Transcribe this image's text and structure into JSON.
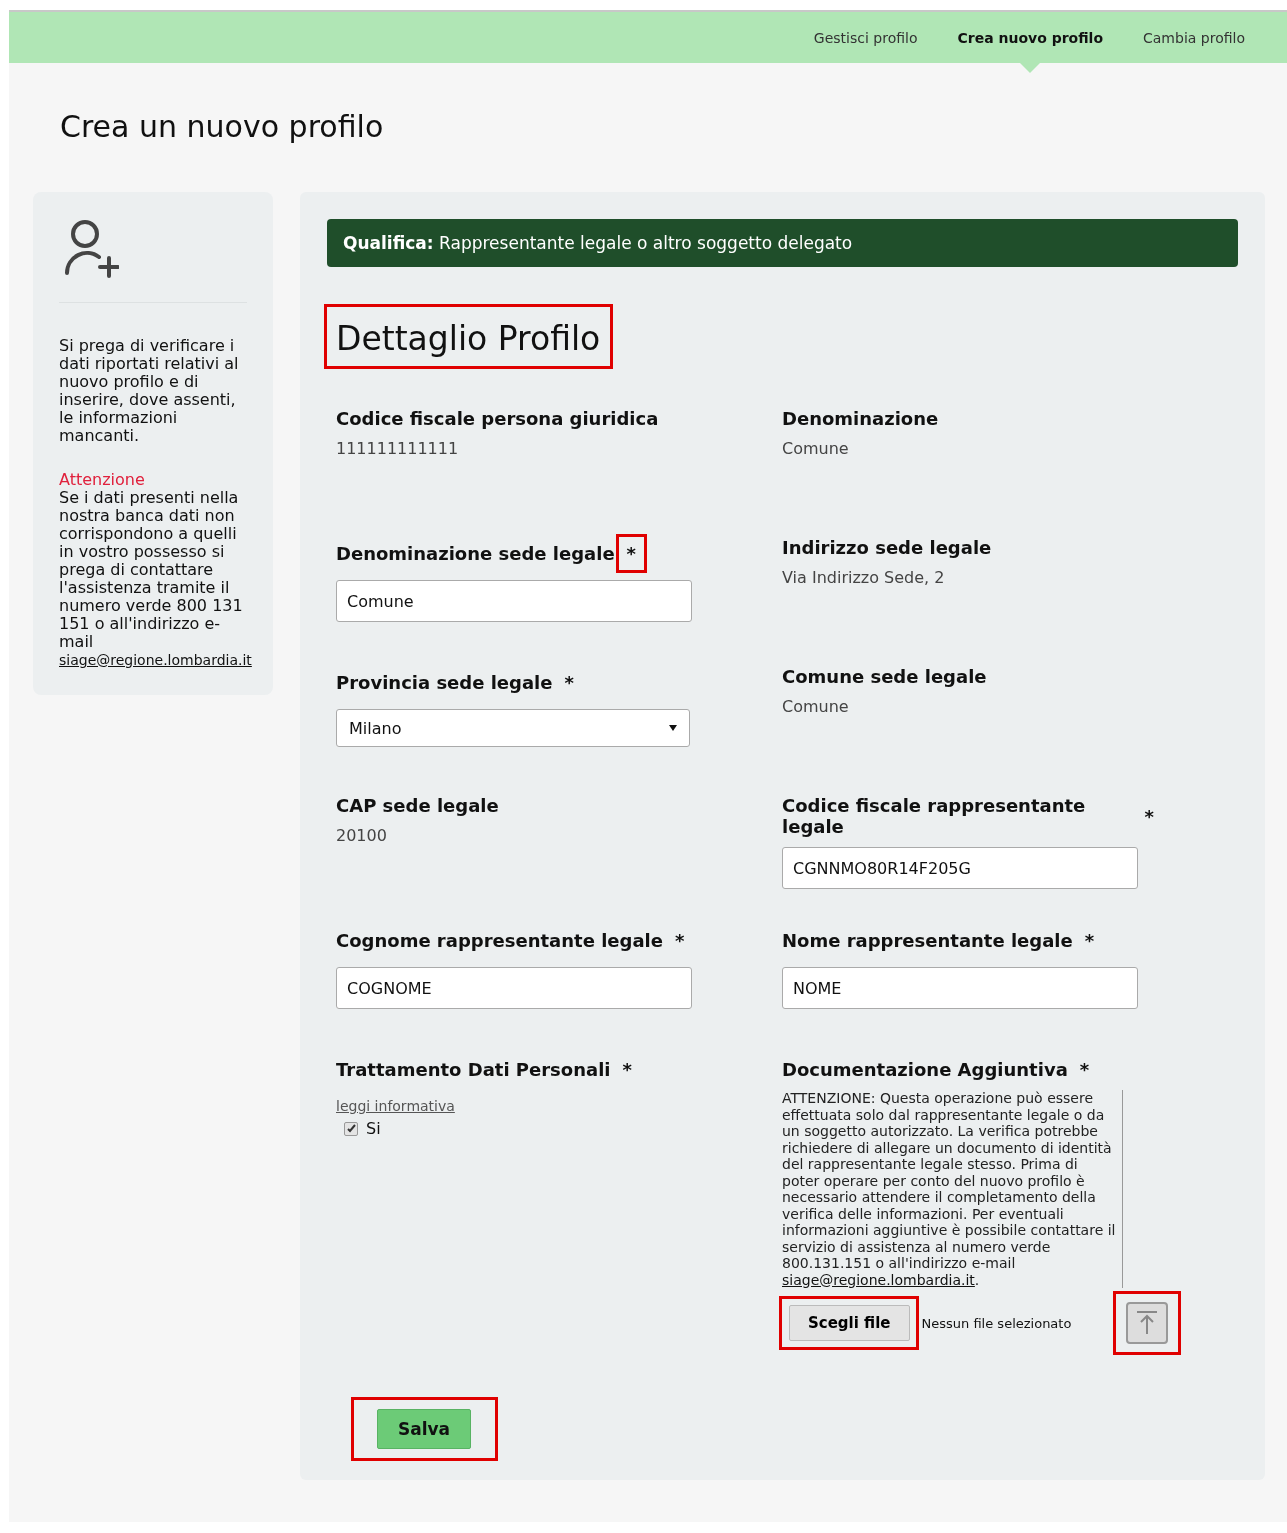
{
  "nav": {
    "items": [
      {
        "label": "Gestisci profilo",
        "selected": false
      },
      {
        "label": "Crea nuovo profilo",
        "selected": true
      },
      {
        "label": "Cambia profilo",
        "selected": false
      }
    ]
  },
  "page_title": "Crea un nuovo profilo",
  "sidebar": {
    "intro": "Si prega di verificare i dati riportati relativi al nuovo profilo e di inserire, dove assenti, le informazioni mancanti.",
    "warning_title": "Attenzione",
    "warning_text": "Se i dati presenti nella nostra banca dati non corrispondono a quelli in vostro possesso si prega di contattare l'assistenza tramite il numero verde 800 131 151 o all'indirizzo e-mail",
    "email": "siage@regione.lombardia.it"
  },
  "qualifica": {
    "label": "Qualifica:",
    "value": "Rappresentante legale o altro soggetto delegato"
  },
  "section_title": {
    "text": "Dettaglio Profilo",
    "highlighted": true
  },
  "fields": [
    {
      "kind": "text",
      "label": "Codice fiscale persona giuridica",
      "value": "111111111111"
    },
    {
      "kind": "text",
      "label": "Denominazione",
      "value": "Comune"
    },
    {
      "kind": "input",
      "label": "Denominazione sede legale",
      "mark": "*",
      "mark_highlighted": true,
      "value": "Comune"
    },
    {
      "kind": "text",
      "label": "Indirizzo sede legale",
      "value": "Via Indirizzo Sede, 2"
    },
    {
      "kind": "select",
      "label": "Provincia sede legale",
      "mark": "*",
      "mark_highlighted": false,
      "value": "Milano"
    },
    {
      "kind": "text",
      "label": "Comune sede legale",
      "value": "Comune"
    },
    {
      "kind": "text",
      "label": "CAP sede legale",
      "value": "20100"
    },
    {
      "kind": "input",
      "label": "Codice fiscale rappresentante legale",
      "mark": "*",
      "mark_highlighted": false,
      "value": "CGNNMO80R14F205G"
    },
    {
      "kind": "input",
      "label": "Cognome rappresentante legale",
      "mark": "*",
      "mark_highlighted": false,
      "value": "COGNOME"
    },
    {
      "kind": "input",
      "label": "Nome rappresentante legale",
      "mark": "*",
      "mark_highlighted": false,
      "value": "NOME"
    },
    {
      "kind": "checkbox",
      "label": "Trattamento Dati Personali",
      "mark": "*",
      "mark_highlighted": false,
      "link": "leggi informativa",
      "option": "Si",
      "checked": true
    },
    {
      "kind": "document",
      "label": "Documentazione Aggiuntiva",
      "mark": "*",
      "mark_highlighted": false,
      "notice": "ATTENZIONE: Questa operazione può essere effettuata solo dal rappresentante legale o da un soggetto autorizzato. La verifica potrebbe richiedere di allegare un documento di identità del rappresentante legale stesso. Prima di poter operare per conto del nuovo profilo è necessario attendere il completamento della verifica delle informazioni. Per eventuali informazioni aggiuntive è possibile contattare il servizio di assistenza al numero verde 800.131.151 o all'indirizzo e-mail",
      "email": "siage@regione.lombardia.it",
      "period": ".",
      "choose_button": "Scegli file",
      "choose_highlighted": true,
      "no_file": "Nessun file selezionato",
      "upload_highlighted": true
    }
  ],
  "save": {
    "label": "Salva",
    "highlighted": true
  }
}
